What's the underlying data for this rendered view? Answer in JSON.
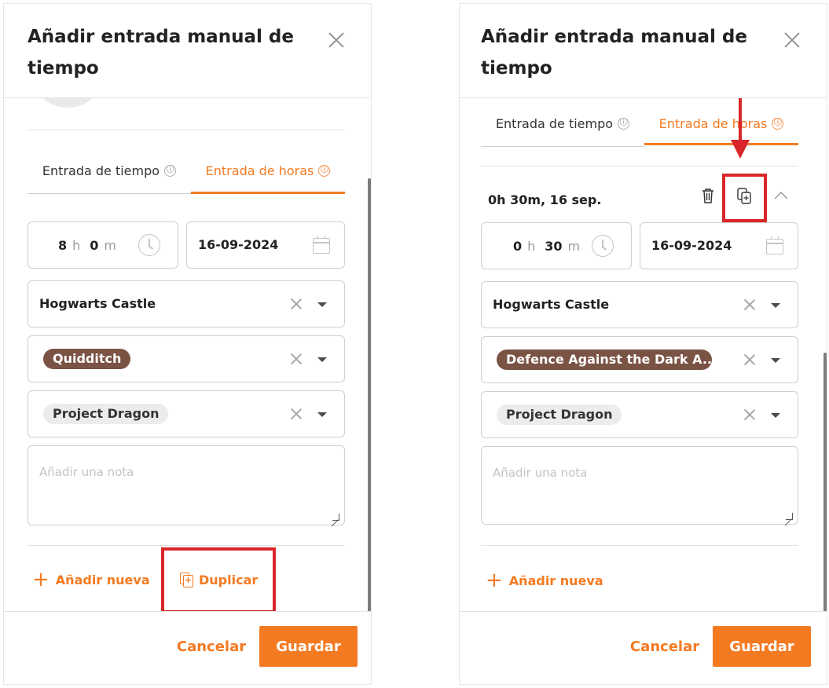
{
  "colors": {
    "accent": "#f47a21",
    "chip_brown": "#7a5344",
    "highlight": "#d9262a"
  },
  "left_panel": {
    "title": "Añadir entrada manual de tiempo",
    "tabs": [
      {
        "label": "Entrada de tiempo",
        "active": false
      },
      {
        "label": "Entrada de horas",
        "active": true
      }
    ],
    "info_icon": "ⓘ",
    "time": {
      "hours": "8",
      "hours_unit": "h",
      "minutes": "0",
      "minutes_unit": "m"
    },
    "date": "16-09-2024",
    "location": "Hogwarts Castle",
    "activity": "Quidditch",
    "project": "Project Dragon",
    "note_placeholder": "Añadir una nota",
    "add_new": "Añadir nueva",
    "duplicate": "Duplicar",
    "cancel": "Cancelar",
    "save": "Guardar"
  },
  "right_panel": {
    "title": "Añadir entrada manual de tiempo",
    "tabs": [
      {
        "label": "Entrada de tiempo",
        "active": false
      },
      {
        "label": "Entrada de horas",
        "active": true
      }
    ],
    "info_icon": "ⓘ",
    "entry_summary": "0h 30m, 16 sep.",
    "time": {
      "hours": "0",
      "hours_unit": "h",
      "minutes": "30",
      "minutes_unit": "m"
    },
    "date": "16-09-2024",
    "location": "Hogwarts Castle",
    "activity": "Defence Against the Dark A...",
    "project": "Project Dragon",
    "note_placeholder": "Añadir una nota",
    "add_new": "Añadir nueva",
    "cancel": "Cancelar",
    "save": "Guardar"
  },
  "icons": [
    "close-icon",
    "info-icon",
    "clock-icon",
    "calendar-icon",
    "clear-icon",
    "chevron-down-icon",
    "plus-icon",
    "duplicate-icon",
    "trash-icon",
    "chevron-up-icon",
    "arrow-down-icon"
  ]
}
